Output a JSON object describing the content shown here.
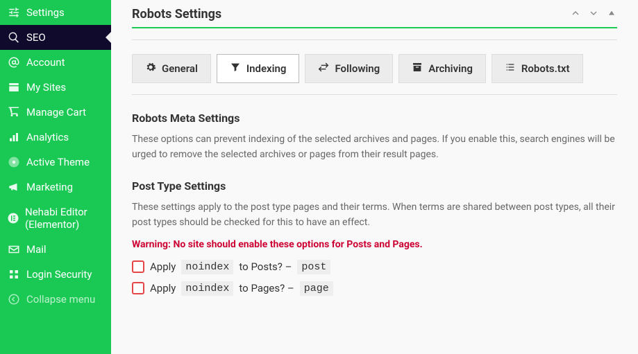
{
  "sidebar": {
    "items": [
      {
        "label": "Settings"
      },
      {
        "label": "SEO"
      },
      {
        "label": "Account"
      },
      {
        "label": "My Sites"
      },
      {
        "label": "Manage Cart"
      },
      {
        "label": "Analytics"
      },
      {
        "label": "Active Theme"
      },
      {
        "label": "Marketing"
      },
      {
        "label": "Nehabi Editor (Elementor)"
      },
      {
        "label": "Mail"
      },
      {
        "label": "Login Security"
      }
    ],
    "collapse": "Collapse menu"
  },
  "panel": {
    "title": "Robots Settings"
  },
  "tabs": {
    "general": "General",
    "indexing": "Indexing",
    "following": "Following",
    "archiving": "Archiving",
    "robotstxt": "Robots.txt"
  },
  "meta": {
    "title": "Robots Meta Settings",
    "desc": "These options can prevent indexing of the selected archives and pages. If you enable this, search engines will be urged to remove the selected archives or pages from their result pages."
  },
  "posttype": {
    "title": "Post Type Settings",
    "desc": "These settings apply to the post type pages and their terms. When terms are shared between post types, all their post types should be checked for this to have an effect.",
    "warning": "Warning: No site should enable these options for Posts and Pages.",
    "rows": [
      {
        "pre": "Apply ",
        "code1": "noindex",
        "mid": " to Posts? – ",
        "code2": "post"
      },
      {
        "pre": "Apply ",
        "code1": "noindex",
        "mid": " to Pages? – ",
        "code2": "page"
      }
    ]
  }
}
